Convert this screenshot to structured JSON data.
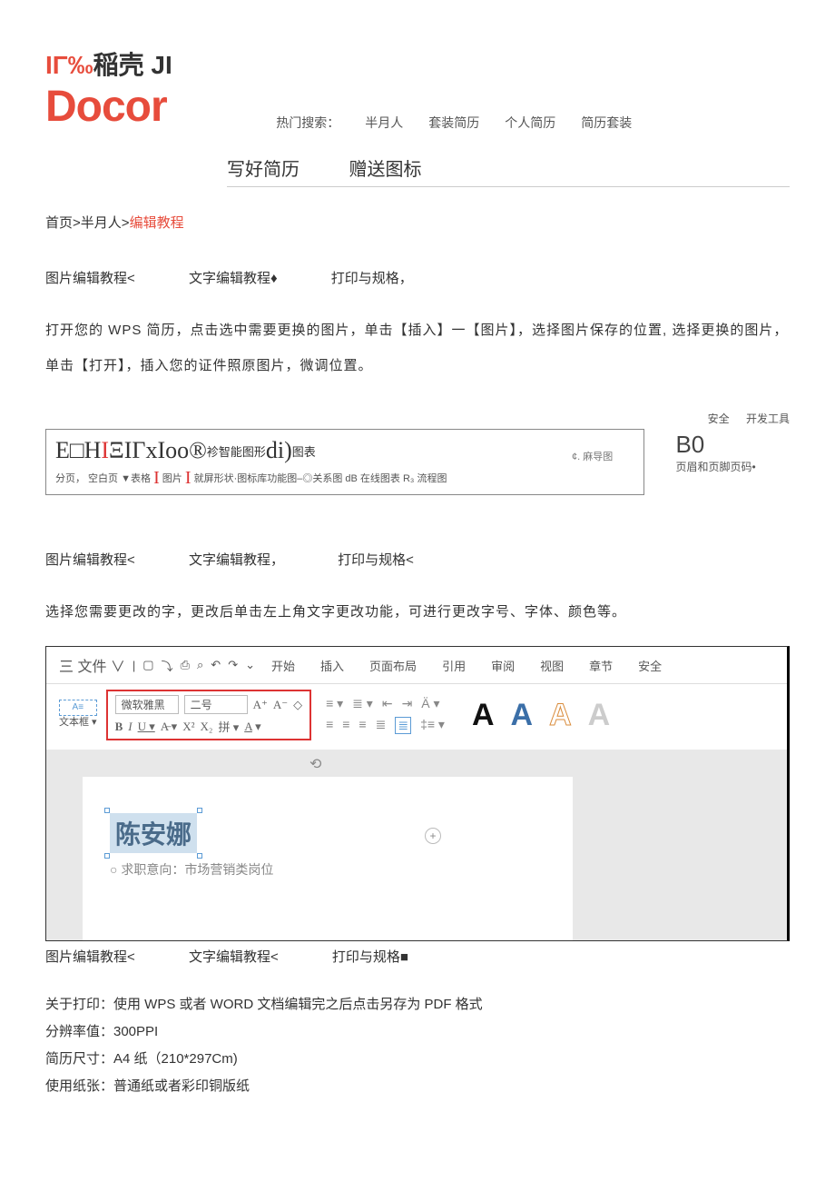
{
  "logo": {
    "top_prefix": "IΓ‰",
    "top_cn": "稲壳",
    "top_suffix": " JI",
    "main": "Docor"
  },
  "hot_search": {
    "label": "热门搜索：",
    "items": [
      "半月人",
      "套装简历",
      "个人简历",
      "简历套装"
    ]
  },
  "nav": {
    "tab1": "写好简历",
    "tab2": "赠送图标"
  },
  "breadcrumb": {
    "home": "首页",
    "sep": ">",
    "mid": "半月人",
    "last": "编辑教程"
  },
  "section1": {
    "tabs": {
      "a": "图片编辑教程<",
      "b": "文字编辑教程♦",
      "c": "打印与规格，"
    },
    "para": "打开您的 WPS 简历，点击选中需要更换的图片，单击【插入】一【图片】，选择图片保存的位置, 选择更换的图片，单击【打开】，插入您的证件照原图片，微调位置。"
  },
  "wps1": {
    "right1": "安全",
    "right2": "开发工具",
    "line1_a": "E□H",
    "line1_b": "I",
    "line1_c": "ΞIΓxIoo®",
    "line1_d": "袗智能图形",
    "line1_e": "di)",
    "line1_f": "图表",
    "mind": "¢. 麻导图",
    "line2": "分页， 空白页 ▼表格 ",
    "line2_i1": "I",
    "line2_mid": " 图片 ",
    "line2_i2": "I",
    "line2_end": " 就屏形状·图标库功能图‒◎关系图 dB  在线图表 R₃ 流程图",
    "side_big": "B0",
    "side_sub": "页眉和页脚页码•"
  },
  "section2": {
    "tabs": {
      "a": "图片编辑教程<",
      "b": "文字编辑教程，",
      "c": "打印与规格<"
    },
    "para": "选择您需要更改的字，更改后单击左上角文字更改功能，可进行更改字号、字体、颜色等。"
  },
  "editor": {
    "file": "三 文件 ∨",
    "menus": [
      "开始",
      "插入",
      "页面布局",
      "引用",
      "审阅",
      "视图",
      "章节",
      "安全"
    ],
    "textframe_box": "A≡",
    "textframe_label": "文本框 ▾",
    "font_name": "微软雅黑",
    "font_size": "二号",
    "name": "陈安娜",
    "subline": "○ 求职意向：市场营销类岗位"
  },
  "section3": {
    "tabs": {
      "a": "图片编辑教程<",
      "b": "文字编辑教程<",
      "c": "打印与规格■"
    },
    "lines": [
      "关于打印：使用 WPS 或者 WORD 文档编辑完之后点击另存为 PDF 格式",
      "分辨率值：300PPI",
      "简历尺寸：A4 纸（210*297Cm)",
      "使用纸张：普通纸或者彩印铜版纸"
    ]
  }
}
